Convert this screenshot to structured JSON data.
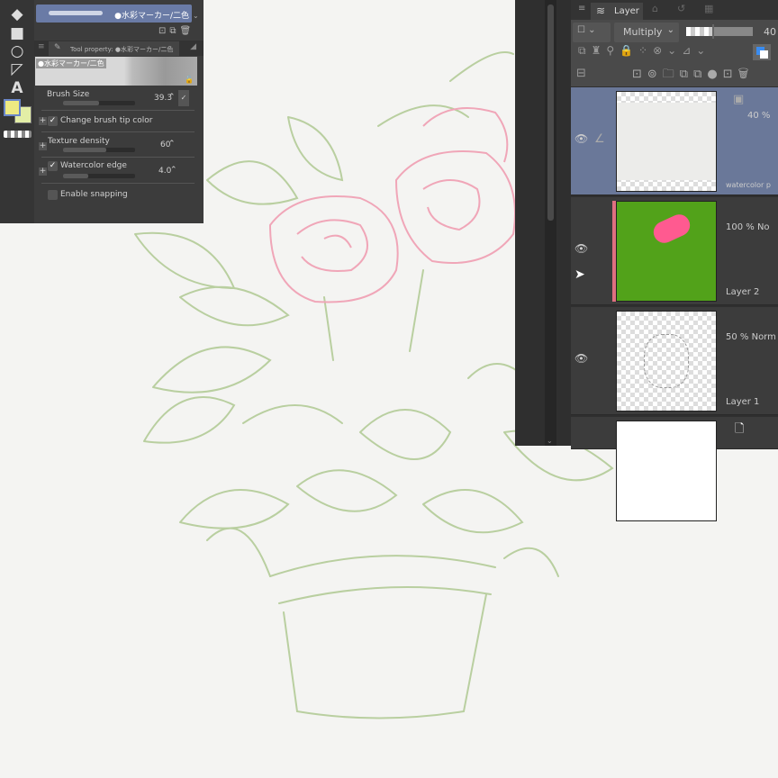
{
  "tool_panel": {
    "brush_name": "●水彩マーカー/二色",
    "tab_label": "Tool property: ●水彩マーカー/二色",
    "preview_name": "●水彩マーカー/二色",
    "brush_size_label": "Brush Size",
    "brush_size_value": "39.3",
    "brush_size_fraction": 0.5,
    "change_tip_color_label": "Change brush tip color",
    "change_tip_color_checked": true,
    "texture_density_label": "Texture density",
    "texture_density_value": "60",
    "texture_density_fraction": 0.6,
    "watercolor_edge_label": "Watercolor edge",
    "watercolor_edge_checked": true,
    "watercolor_edge_value": "4.0",
    "watercolor_edge_fraction": 0.35,
    "snapping_label": "Enable snapping",
    "snapping_checked": false,
    "main_color": "#eeea82",
    "sub_color": "#e3eea6"
  },
  "layer_panel": {
    "tab_label": "Layer",
    "blend_mode": "Multiply",
    "opacity": "40",
    "layers": [
      {
        "name": "watercolor p",
        "info": "40 %",
        "selected": true
      },
      {
        "name": "Layer 2",
        "info": "100 % No",
        "color": "#52a21a",
        "mark": "#ff5a90"
      },
      {
        "name": "Layer 1",
        "info": "50 % Norm"
      },
      {
        "name": "",
        "info": ""
      }
    ]
  }
}
